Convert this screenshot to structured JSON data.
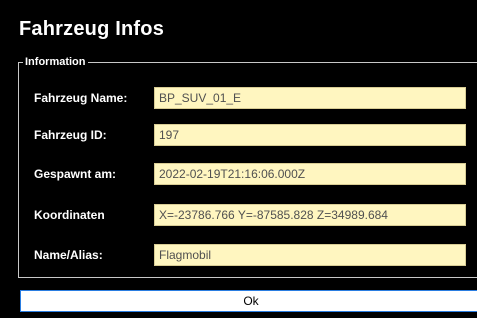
{
  "window": {
    "title": "Fahrzeug Infos"
  },
  "group": {
    "label": "Information"
  },
  "fields": [
    {
      "label": "Fahrzeug Name:",
      "value": "BP_SUV_01_E"
    },
    {
      "label": "Fahrzeug ID:",
      "value": "197"
    },
    {
      "label": "Gespawnt am:",
      "value": "2022-02-19T21:16:06.000Z"
    },
    {
      "label": "Koordinaten",
      "value": "X=-23786.766 Y=-87585.828 Z=34989.684"
    },
    {
      "label": "Name/Alias:",
      "value": "Flagmobil"
    }
  ],
  "buttons": {
    "ok_label": "Ok"
  },
  "colors": {
    "background": "#000000",
    "field_background": "#fff6c0",
    "field_text": "#505050",
    "button_border": "#2a7de1"
  }
}
